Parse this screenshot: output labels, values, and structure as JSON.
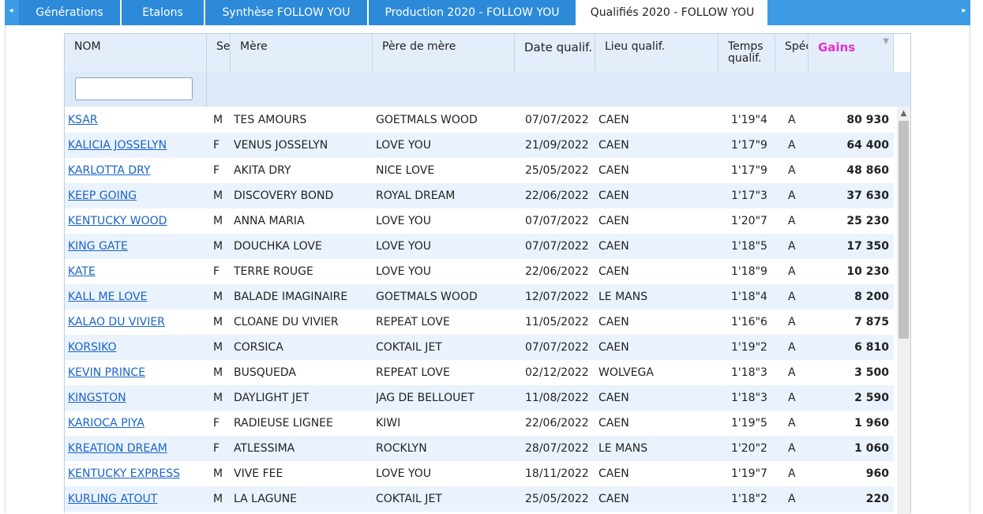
{
  "tabs": [
    {
      "label": "Générations",
      "active": false
    },
    {
      "label": "Etalons",
      "active": false
    },
    {
      "label": "Synthèse FOLLOW YOU",
      "active": false
    },
    {
      "label": "Production 2020 - FOLLOW YOU",
      "active": false
    },
    {
      "label": "Qualifiés 2020 - FOLLOW YOU",
      "active": true
    }
  ],
  "tab_arrows": {
    "left": "◂",
    "right": "▸"
  },
  "columns": {
    "nom": "NOM",
    "sexe": "Se",
    "mere": "Mère",
    "pere_mere": "Père de mère",
    "date": "Date qualif.",
    "lieu": "Lieu qualif.",
    "temps": "Temps qualif.",
    "spec": "Spéc",
    "gains": "Gains"
  },
  "filter": {
    "nom_value": ""
  },
  "rows": [
    {
      "nom": "KSAR",
      "sexe": "M",
      "mere": "TES AMOURS",
      "pere_mere": "GOETMALS WOOD",
      "date": "07/07/2022",
      "lieu": "CAEN",
      "temps": "1'19\"4",
      "spec": "A",
      "gains": "80 930"
    },
    {
      "nom": "KALICIA JOSSELYN",
      "sexe": "F",
      "mere": "VENUS JOSSELYN",
      "pere_mere": "LOVE YOU",
      "date": "21/09/2022",
      "lieu": "CAEN",
      "temps": "1'17\"9",
      "spec": "A",
      "gains": "64 400"
    },
    {
      "nom": "KARLOTTA DRY",
      "sexe": "F",
      "mere": "AKITA DRY",
      "pere_mere": "NICE LOVE",
      "date": "25/05/2022",
      "lieu": "CAEN",
      "temps": "1'17\"9",
      "spec": "A",
      "gains": "48 860"
    },
    {
      "nom": "KEEP GOING",
      "sexe": "M",
      "mere": "DISCOVERY BOND",
      "pere_mere": "ROYAL DREAM",
      "date": "22/06/2022",
      "lieu": "CAEN",
      "temps": "1'17\"3",
      "spec": "A",
      "gains": "37 630"
    },
    {
      "nom": "KENTUCKY WOOD",
      "sexe": "M",
      "mere": "ANNA MARIA",
      "pere_mere": "LOVE YOU",
      "date": "07/07/2022",
      "lieu": "CAEN",
      "temps": "1'20\"7",
      "spec": "A",
      "gains": "25 230"
    },
    {
      "nom": "KING GATE",
      "sexe": "M",
      "mere": "DOUCHKA LOVE",
      "pere_mere": "LOVE YOU",
      "date": "07/07/2022",
      "lieu": "CAEN",
      "temps": "1'18\"5",
      "spec": "A",
      "gains": "17 350"
    },
    {
      "nom": "KATE",
      "sexe": "F",
      "mere": "TERRE ROUGE",
      "pere_mere": "LOVE YOU",
      "date": "22/06/2022",
      "lieu": "CAEN",
      "temps": "1'18\"9",
      "spec": "A",
      "gains": "10 230"
    },
    {
      "nom": "KALL ME LOVE",
      "sexe": "M",
      "mere": "BALADE IMAGINAIRE",
      "pere_mere": "GOETMALS WOOD",
      "date": "12/07/2022",
      "lieu": "LE MANS",
      "temps": "1'18\"4",
      "spec": "A",
      "gains": "8 200"
    },
    {
      "nom": "KALAO DU VIVIER",
      "sexe": "M",
      "mere": "CLOANE DU VIVIER",
      "pere_mere": "REPEAT LOVE",
      "date": "11/05/2022",
      "lieu": "CAEN",
      "temps": "1'16\"6",
      "spec": "A",
      "gains": "7 875"
    },
    {
      "nom": "KORSIKO",
      "sexe": "M",
      "mere": "CORSICA",
      "pere_mere": "COKTAIL JET",
      "date": "07/07/2022",
      "lieu": "CAEN",
      "temps": "1'19\"2",
      "spec": "A",
      "gains": "6 810"
    },
    {
      "nom": "KEVIN PRINCE",
      "sexe": "M",
      "mere": "BUSQUEDA",
      "pere_mere": "REPEAT LOVE",
      "date": "02/12/2022",
      "lieu": "WOLVEGA",
      "temps": "1'18\"3",
      "spec": "A",
      "gains": "3 500"
    },
    {
      "nom": "KINGSTON",
      "sexe": "M",
      "mere": "DAYLIGHT JET",
      "pere_mere": "JAG DE BELLOUET",
      "date": "11/08/2022",
      "lieu": "CAEN",
      "temps": "1'18\"3",
      "spec": "A",
      "gains": "2 590"
    },
    {
      "nom": "KARIOCA PIYA",
      "sexe": "F",
      "mere": "RADIEUSE LIGNEE",
      "pere_mere": "KIWI",
      "date": "22/06/2022",
      "lieu": "CAEN",
      "temps": "1'19\"5",
      "spec": "A",
      "gains": "1 960"
    },
    {
      "nom": "KREATION DREAM",
      "sexe": "F",
      "mere": "ATLESSIMA",
      "pere_mere": "ROCKLYN",
      "date": "28/07/2022",
      "lieu": "LE MANS",
      "temps": "1'20\"2",
      "spec": "A",
      "gains": "1 060"
    },
    {
      "nom": "KENTUCKY EXPRESS",
      "sexe": "M",
      "mere": "VIVE FEE",
      "pere_mere": "LOVE YOU",
      "date": "18/11/2022",
      "lieu": "CAEN",
      "temps": "1'19\"7",
      "spec": "A",
      "gains": "960"
    },
    {
      "nom": "KURLING ATOUT",
      "sexe": "M",
      "mere": "LA LAGUNE",
      "pere_mere": "COKTAIL JET",
      "date": "25/05/2022",
      "lieu": "CAEN",
      "temps": "1'18\"2",
      "spec": "A",
      "gains": "220"
    }
  ],
  "colors": {
    "tabbar": "#3d9be6",
    "tab": "#2c8ad8",
    "link": "#1a63c7",
    "gains_header": "#e62ed1",
    "row_alt": "#eaf3fd"
  },
  "icons": {
    "sort": "sort-triangle-icon",
    "scroll_up": "chevron-up-icon"
  }
}
